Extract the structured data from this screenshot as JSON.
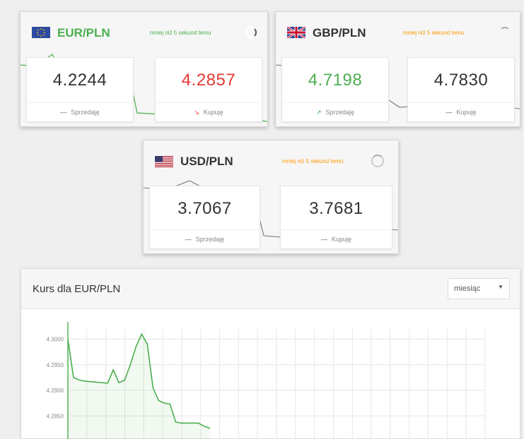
{
  "currencies": [
    {
      "pair": "EUR/PLN",
      "flag": "eu-flag-icon",
      "updated": "mniej niż 5 sekund temu",
      "updated_color": "#4caf50",
      "sell": {
        "value": "4.2244",
        "color": "#333333",
        "label": "Sprzedaję",
        "trend": "flat"
      },
      "buy": {
        "value": "4.2857",
        "color": "#e53935",
        "label": "Kupuję",
        "trend": "down"
      }
    },
    {
      "pair": "GBP/PLN",
      "flag": "uk-flag-icon",
      "updated": "mniej niż 5 sekund temu",
      "updated_color": "#ff9800",
      "sell": {
        "value": "4.7198",
        "color": "#4caf50",
        "label": "Sprzedaję",
        "trend": "up"
      },
      "buy": {
        "value": "4.7830",
        "color": "#333333",
        "label": "Kupuję",
        "trend": "flat"
      }
    },
    {
      "pair": "USD/PLN",
      "flag": "us-flag-icon",
      "updated": "mniej niż 5 sekund temu",
      "updated_color": "#ff9800",
      "sell": {
        "value": "3.7067",
        "color": "#333333",
        "label": "Sprzedaję",
        "trend": "flat"
      },
      "buy": {
        "value": "3.7681",
        "color": "#333333",
        "label": "Kupuję",
        "trend": "flat"
      }
    }
  ],
  "chart_panel": {
    "title": "Kurs dla EUR/PLN",
    "period_selected": "miesiąc"
  },
  "chart_data": {
    "type": "line",
    "title": "",
    "xlabel": "",
    "ylabel": "",
    "y_ticks": [
      "4.3000",
      "4.2950",
      "4.2900",
      "4.2850"
    ],
    "ylim": [
      4.2835,
      4.302
    ],
    "grid": true,
    "series": [
      {
        "color": "#4caf50",
        "values": [
          4.3,
          4.2925,
          4.292,
          4.2918,
          4.2917,
          4.2916,
          4.2915,
          4.2914,
          4.294,
          4.2915,
          4.292,
          4.295,
          4.2985,
          4.301,
          4.299,
          4.2905,
          4.288,
          4.2875,
          4.2873,
          4.2838,
          4.2836,
          4.2836,
          4.2836,
          4.2836,
          4.283,
          4.2826
        ]
      }
    ]
  }
}
